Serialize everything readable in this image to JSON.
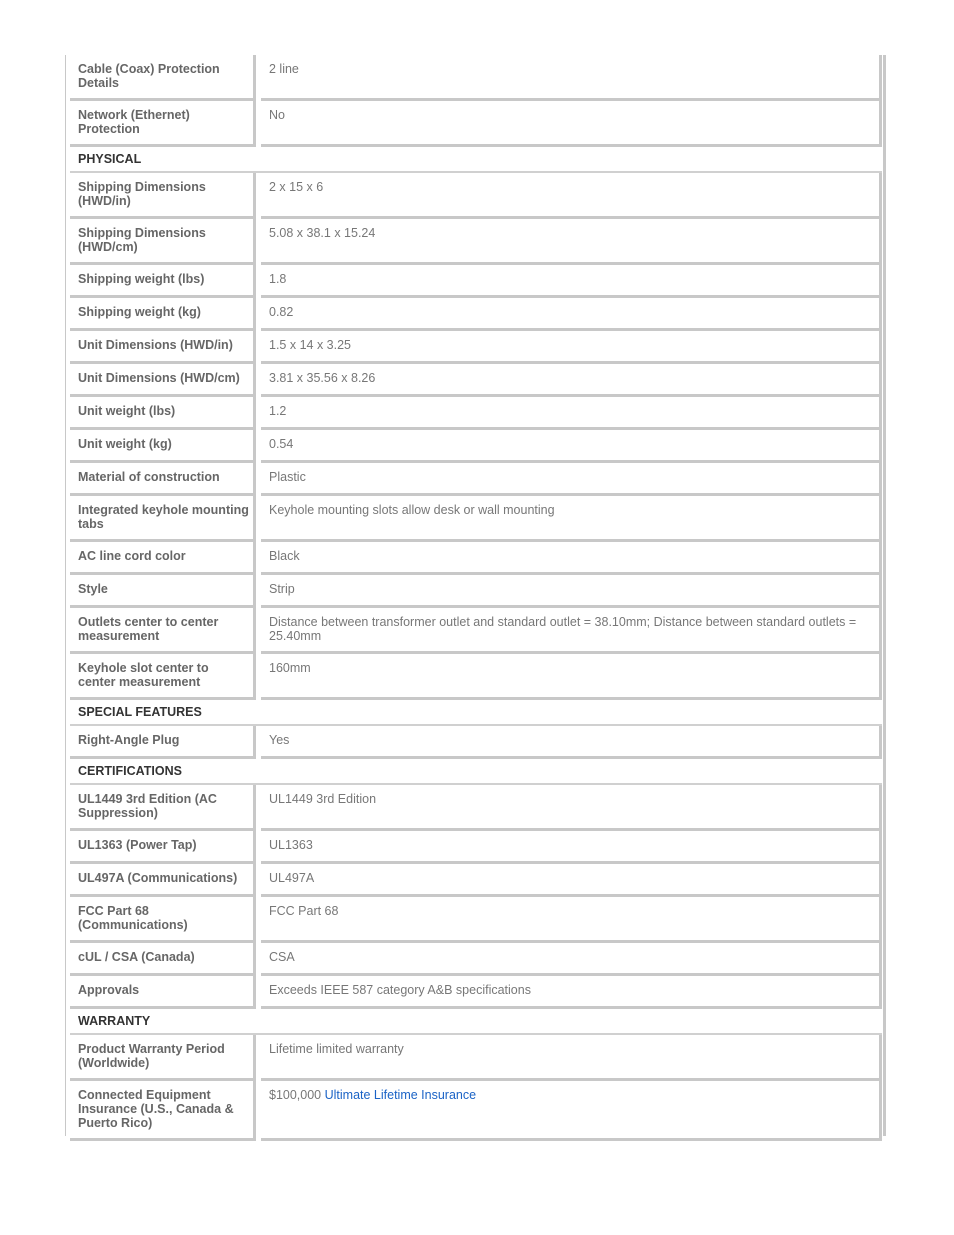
{
  "rows": [
    {
      "type": "row",
      "label": "Cable (Coax) Protection Details",
      "value": "2 line"
    },
    {
      "type": "row",
      "label": "Network (Ethernet) Protection",
      "value": "No"
    },
    {
      "type": "section",
      "label": "PHYSICAL"
    },
    {
      "type": "row",
      "label": "Shipping Dimensions (HWD/in)",
      "value": "2 x 15 x 6"
    },
    {
      "type": "row",
      "label": "Shipping Dimensions (HWD/cm)",
      "value": "5.08 x 38.1 x 15.24"
    },
    {
      "type": "row",
      "label": "Shipping weight (lbs)",
      "value": "1.8"
    },
    {
      "type": "row",
      "label": "Shipping weight (kg)",
      "value": "0.82"
    },
    {
      "type": "row",
      "label": "Unit Dimensions (HWD/in)",
      "value": "1.5 x 14 x 3.25"
    },
    {
      "type": "row",
      "label": "Unit Dimensions (HWD/cm)",
      "value": "3.81 x 35.56 x 8.26"
    },
    {
      "type": "row",
      "label": "Unit weight (lbs)",
      "value": "1.2"
    },
    {
      "type": "row",
      "label": "Unit weight (kg)",
      "value": "0.54"
    },
    {
      "type": "row",
      "label": "Material of construction",
      "value": "Plastic"
    },
    {
      "type": "row",
      "label": "Integrated keyhole mounting tabs",
      "value": "Keyhole mounting slots allow desk or wall mounting"
    },
    {
      "type": "row",
      "label": "AC line cord color",
      "value": "Black"
    },
    {
      "type": "row",
      "label": "Style",
      "value": "Strip"
    },
    {
      "type": "row",
      "label": "Outlets center to center measurement",
      "value": "Distance between transformer outlet and standard outlet = 38.10mm; Distance between standard outlets = 25.40mm"
    },
    {
      "type": "row",
      "label": "Keyhole slot center to center measurement",
      "value": "160mm"
    },
    {
      "type": "section",
      "label": "SPECIAL FEATURES"
    },
    {
      "type": "row",
      "label": "Right-Angle Plug",
      "value": "Yes"
    },
    {
      "type": "section",
      "label": "CERTIFICATIONS"
    },
    {
      "type": "row",
      "label": "UL1449 3rd Edition (AC Suppression)",
      "value": "UL1449 3rd Edition"
    },
    {
      "type": "row",
      "label": "UL1363 (Power Tap)",
      "value": "UL1363"
    },
    {
      "type": "row",
      "label": "UL497A (Communications)",
      "value": "UL497A"
    },
    {
      "type": "row",
      "label": "FCC Part 68 (Communications)",
      "value": "FCC Part 68"
    },
    {
      "type": "row",
      "label": "cUL / CSA (Canada)",
      "value": "CSA"
    },
    {
      "type": "row",
      "label": "Approvals",
      "value": "Exceeds IEEE 587 category A&B specifications"
    },
    {
      "type": "section",
      "label": "WARRANTY"
    },
    {
      "type": "row",
      "label": "Product Warranty Period (Worldwide)",
      "value": "Lifetime limited warranty"
    },
    {
      "type": "row",
      "label": "Connected Equipment Insurance (U.S., Canada & Puerto Rico)",
      "value": "$100,000 ",
      "link": "Ultimate Lifetime Insurance"
    }
  ]
}
